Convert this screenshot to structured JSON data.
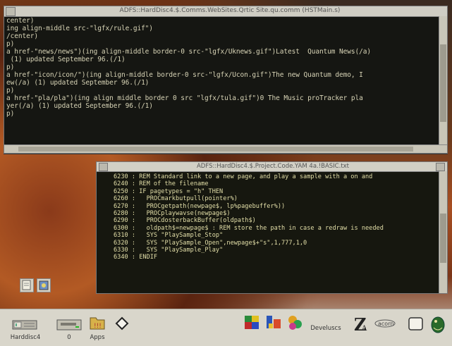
{
  "window_html": {
    "title": "ADFS::HardDisc4.$.Comms.WebSites.Qrtic Site.qu.comm (HSTMain.s)",
    "lines": [
      "center)",
      "ing align-middle src-\"lgfx/rule.gif\")",
      "/center)",
      "p)",
      "a href-\"news/news\")(ing align-middle border-0 src-\"lgfx/Uknews.gif\")Latest  Quantum News(/a)",
      " (1) updated September 96.(/1)",
      "p)",
      "a href-\"icon/icon/\")(ing align-middle border-0 src-\"lgfx/Ucon.gif\")The new Quantum demo, I",
      "ew(/a) (1) updated September 96.(/1)",
      "p)",
      "a href-\"pla/pla\")(ing align middle border 0 src \"lgfx/tula.gif\")0 The Music proTracker pla",
      "yer(/a) (1) updated September 96.(/1)",
      "p)"
    ]
  },
  "window_basic": {
    "title": "ADFS::HardDisc4.$.Project.Code.YAM 4a.!BASIC.txt",
    "lines": [
      {
        "num": "6230",
        "code": " : REM Standard link to a new page, and play a sample with a on and"
      },
      {
        "num": "6240",
        "code": " : REM of the filename"
      },
      {
        "num": "6250",
        "code": " : IF pagetypes = \"h\" THEN"
      },
      {
        "num": "6260",
        "code": " :   PROCmarkbutpull(pointer%)"
      },
      {
        "num": "6270",
        "code": " :   PROCgetpath(newpage$, lp%pagebuffer%))"
      },
      {
        "num": "6280",
        "code": " :   PROCplaywavse(newpage$)"
      },
      {
        "num": "6290",
        "code": " :   PROCdosterbackBuffer(oldpath$)"
      },
      {
        "num": "6300",
        "code": " :   oldpath$=newpage$ : REM store the path in case a redraw is needed"
      },
      {
        "num": "6310",
        "code": " :   SYS \"PlaySample_Stop\""
      },
      {
        "num": "6320",
        "code": " :   SYS \"PlaySample_Open\",newpage$+\"s\",1,777,1,0"
      },
      {
        "num": "6330",
        "code": " :   SYS \"PlaySample_Play\""
      },
      {
        "num": "6340",
        "code": " : ENDIF"
      }
    ]
  },
  "iconbar": {
    "left_items": [
      {
        "label": "Harddisc4",
        "icon": "harddisc-icon"
      },
      {
        "label": "0",
        "icon": "floppy-drive-icon"
      },
      {
        "label": "Apps",
        "icon": "apps-icon"
      },
      {
        "label": "",
        "icon": "diamond-icon"
      }
    ],
    "right_items": [
      {
        "label": "",
        "icon": "palette-icon"
      },
      {
        "label": "",
        "icon": "display-icon"
      },
      {
        "label": "Develuscs",
        "icon": "develuscs-icon"
      },
      {
        "label": "",
        "icon": "font-manager-icon"
      },
      {
        "label": "",
        "icon": "acorn-icon"
      },
      {
        "label": "",
        "icon": "task-manager-icon"
      },
      {
        "label": "",
        "icon": "fish-icon"
      }
    ]
  },
  "colors": {
    "window_background": "#151612",
    "code_text": "#d8d4b6",
    "basic_string": "#7ab0e8",
    "titlebar": "#cfcdc3",
    "iconbar": "#d9d6cb"
  }
}
